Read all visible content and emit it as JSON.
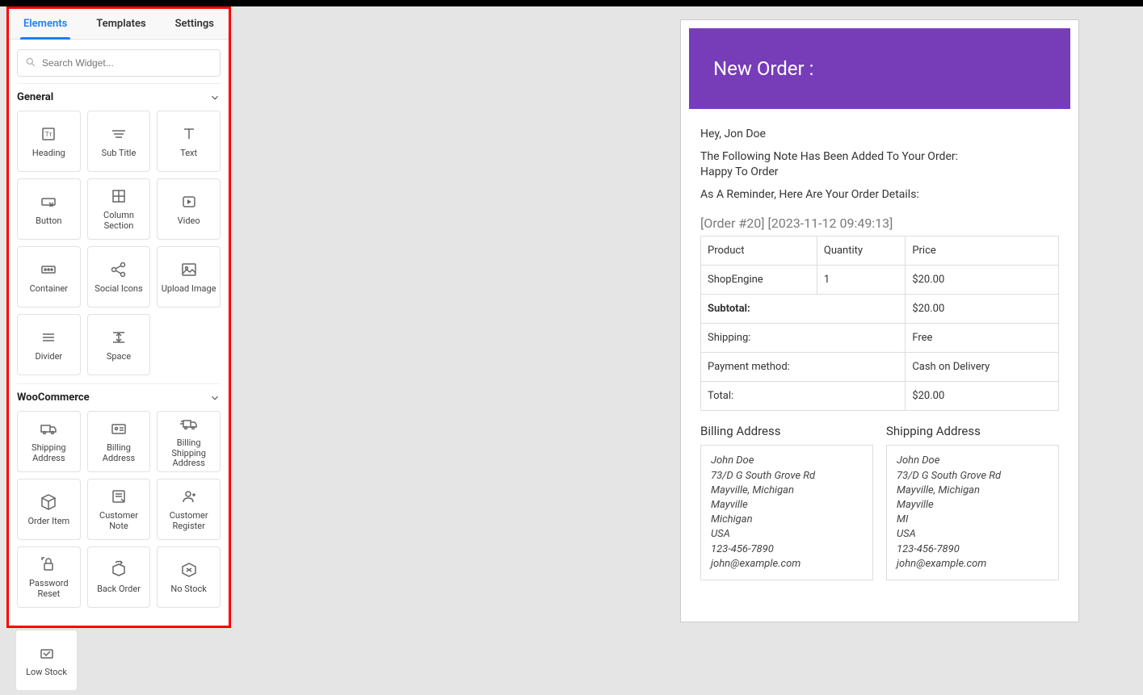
{
  "tabs": {
    "elements": "Elements",
    "templates": "Templates",
    "settings": "Settings"
  },
  "search": {
    "placeholder": "Search Widget..."
  },
  "sections": {
    "general": {
      "title": "General",
      "widgets": [
        "Heading",
        "Sub Title",
        "Text",
        "Button",
        "Column Section",
        "Video",
        "Container",
        "Social Icons",
        "Upload Image",
        "Divider",
        "Space"
      ]
    },
    "woocommerce": {
      "title": "WooCommerce",
      "widgets": [
        "Shipping Address",
        "Billing Address",
        "Billing Shipping Address",
        "Order Item",
        "Customer Note",
        "Customer Register",
        "Password Reset",
        "Back Order",
        "No Stock",
        "Low Stock"
      ]
    }
  },
  "email": {
    "title": "New Order :",
    "greeting": "Hey, Jon Doe",
    "note_intro": "The Following Note Has Been Added To Your Order:",
    "note_text": "Happy To Order",
    "reminder": "As A Reminder, Here Are Your Order Details:",
    "order_meta": "[Order #20] [2023-11-12 09:49:13]",
    "headers": {
      "product": "Product",
      "quantity": "Quantity",
      "price": "Price"
    },
    "rows": [
      {
        "product": "ShopEngine",
        "qty": "1",
        "price": "$20.00"
      }
    ],
    "summary": {
      "subtotal_label": "Subtotal:",
      "subtotal": "$20.00",
      "shipping_label": "Shipping:",
      "shipping": "Free",
      "payment_label": "Payment method:",
      "payment": "Cash on Delivery",
      "total_label": "Total:",
      "total": "$20.00"
    },
    "billing": {
      "title": "Billing Address",
      "name": "John Doe",
      "street": "73/D G South Grove Rd",
      "citystate": "Mayville, Michigan",
      "city": "Mayville",
      "state": "Michigan",
      "country": "USA",
      "phone": "123-456-7890",
      "emailaddr": "john@example.com"
    },
    "shipping_addr": {
      "title": "Shipping Address",
      "name": "John Doe",
      "street": "73/D G South Grove Rd",
      "citystate": "Mayville, Michigan",
      "city": "Mayville",
      "state": "MI",
      "country": "USA",
      "phone": "123-456-7890",
      "emailaddr": "john@example.com"
    }
  }
}
